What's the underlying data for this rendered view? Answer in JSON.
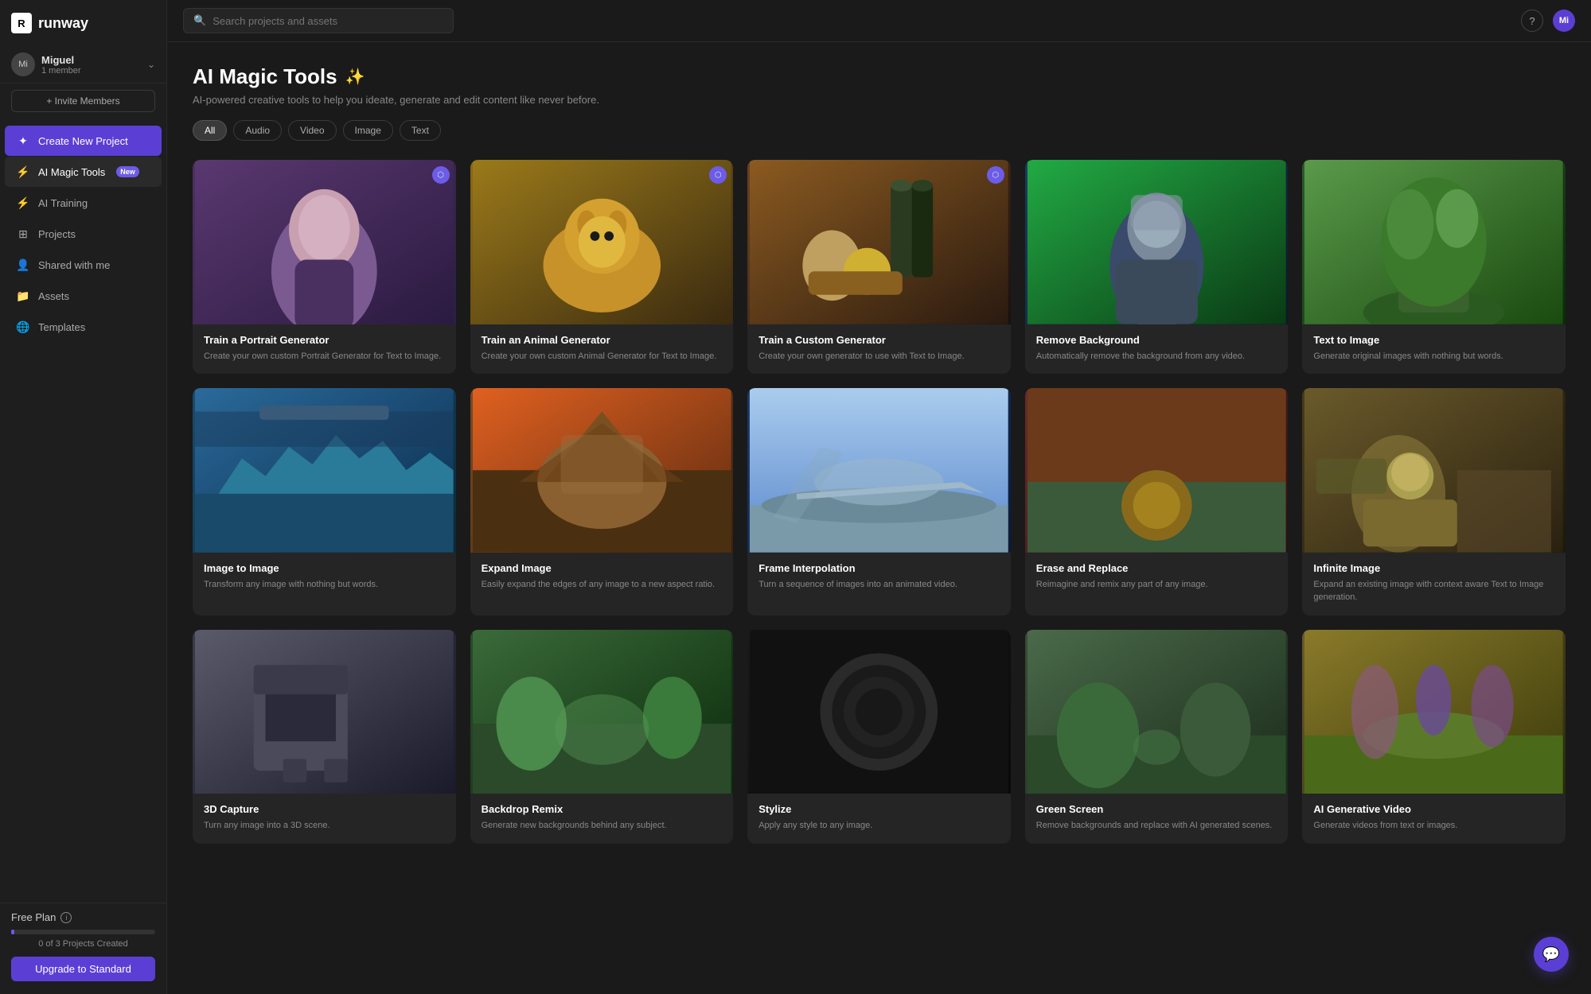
{
  "sidebar": {
    "logo": {
      "icon": "R",
      "label": "runway"
    },
    "user": {
      "initials": "Mi",
      "name": "Miguel",
      "role": "1 member"
    },
    "invite_label": "+ Invite Members",
    "nav": [
      {
        "id": "create",
        "label": "Create New Project",
        "icon": "✦",
        "active": false,
        "special": "create",
        "badge": ""
      },
      {
        "id": "magic",
        "label": "AI Magic Tools",
        "icon": "⚡",
        "active": true,
        "special": "",
        "badge": "New"
      },
      {
        "id": "training",
        "label": "AI Training",
        "icon": "⚡",
        "active": false,
        "special": "",
        "badge": ""
      },
      {
        "id": "projects",
        "label": "Projects",
        "icon": "⊞",
        "active": false,
        "special": "",
        "badge": ""
      },
      {
        "id": "shared",
        "label": "Shared with me",
        "icon": "👤",
        "active": false,
        "special": "",
        "badge": ""
      },
      {
        "id": "assets",
        "label": "Assets",
        "icon": "📁",
        "active": false,
        "special": "",
        "badge": ""
      },
      {
        "id": "templates",
        "label": "Templates",
        "icon": "🌐",
        "active": false,
        "special": "",
        "badge": ""
      }
    ],
    "bottom": {
      "plan_label": "Free Plan",
      "info_tooltip": "i",
      "progress_label": "0 of 3 Projects Created",
      "upgrade_label": "Upgrade to Standard"
    }
  },
  "topbar": {
    "search_placeholder": "Search projects and assets",
    "help_icon": "?",
    "user_initials": "Mi"
  },
  "page": {
    "title": "AI Magic Tools",
    "wand": "✨",
    "subtitle": "AI-powered creative tools to help you ideate, generate and edit content like never before.",
    "filters": [
      {
        "label": "All",
        "active": true
      },
      {
        "label": "Audio",
        "active": false
      },
      {
        "label": "Video",
        "active": false
      },
      {
        "label": "Image",
        "active": false
      },
      {
        "label": "Text",
        "active": false
      }
    ],
    "tools": [
      {
        "id": "portrait",
        "title": "Train a Portrait Generator",
        "desc": "Create your own custom Portrait Generator for Text to Image.",
        "img_class": "img-portrait",
        "has_badge": true,
        "emoji": "👩"
      },
      {
        "id": "animal",
        "title": "Train an Animal Generator",
        "desc": "Create your own custom Animal Generator for Text to Image.",
        "img_class": "img-animal",
        "has_badge": true,
        "emoji": "🐕"
      },
      {
        "id": "custom",
        "title": "Train a Custom Generator",
        "desc": "Create your own generator to use with Text to Image.",
        "img_class": "img-custom",
        "has_badge": true,
        "emoji": "🍷"
      },
      {
        "id": "removebg",
        "title": "Remove Background",
        "desc": "Automatically remove the background from any video.",
        "img_class": "img-background",
        "has_badge": false,
        "emoji": "🪖"
      },
      {
        "id": "text2image",
        "title": "Text to Image",
        "desc": "Generate original images with nothing but words.",
        "img_class": "img-text2image",
        "has_badge": false,
        "emoji": "🌳"
      },
      {
        "id": "img2img",
        "title": "Image to Image",
        "desc": "Transform any image with nothing but words.",
        "img_class": "img-img2img",
        "has_badge": false,
        "emoji": "🗼"
      },
      {
        "id": "expand",
        "title": "Expand Image",
        "desc": "Easily expand the edges of any image to a new aspect ratio.",
        "img_class": "img-expand",
        "has_badge": false,
        "emoji": "🏔️"
      },
      {
        "id": "frame",
        "title": "Frame Interpolation",
        "desc": "Turn a sequence of images into an animated video.",
        "img_class": "img-frame",
        "has_badge": false,
        "emoji": "✈️"
      },
      {
        "id": "erase",
        "title": "Erase and Replace",
        "desc": "Reimagine and remix any part of any image.",
        "img_class": "img-erase",
        "has_badge": false,
        "emoji": "⚽"
      },
      {
        "id": "infinite",
        "title": "Infinite Image",
        "desc": "Expand an existing image with context aware Text to Image generation.",
        "img_class": "img-infinite",
        "has_badge": false,
        "emoji": "🐱"
      },
      {
        "id": "row3-1",
        "title": "3D Capture",
        "desc": "Turn any image into a 3D scene.",
        "img_class": "img-r1",
        "has_badge": false,
        "emoji": "🪑"
      },
      {
        "id": "row3-2",
        "title": "Backdrop Remix",
        "desc": "Generate new backgrounds behind any subject.",
        "img_class": "img-r2",
        "has_badge": false,
        "emoji": "🌿"
      },
      {
        "id": "row3-3",
        "title": "Stylize",
        "desc": "Apply any style to any image.",
        "img_class": "img-r3",
        "has_badge": false,
        "emoji": "🌑"
      },
      {
        "id": "row3-4",
        "title": "Green Screen",
        "desc": "Remove backgrounds and replace with AI generated scenes.",
        "img_class": "img-r4",
        "has_badge": false,
        "emoji": "🌲"
      },
      {
        "id": "row3-5",
        "title": "AI Generative Video",
        "desc": "Generate videos from text or images.",
        "img_class": "img-r5",
        "has_badge": false,
        "emoji": "💜"
      }
    ]
  }
}
